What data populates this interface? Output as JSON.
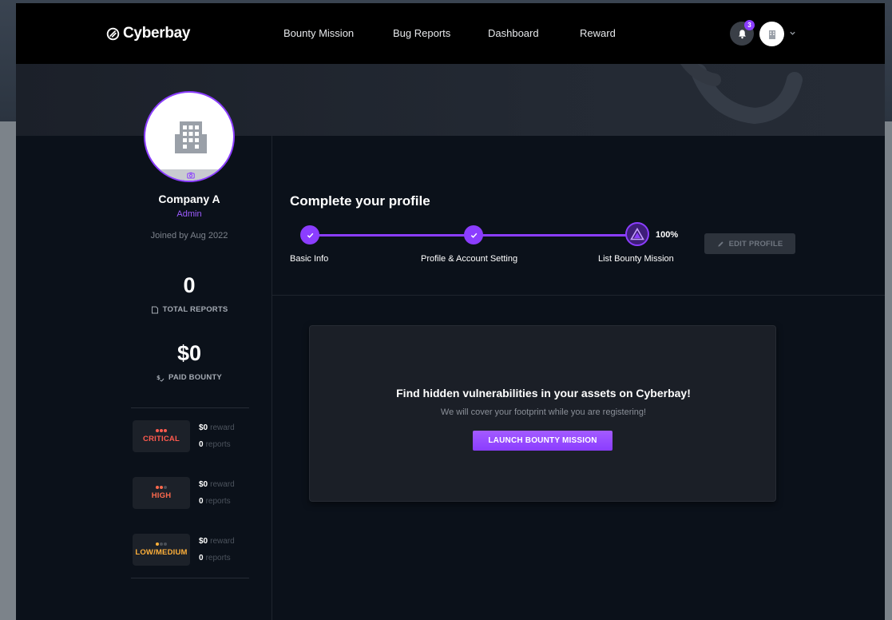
{
  "brand": {
    "name": "Cyberbay"
  },
  "nav": {
    "links": [
      "Bounty Mission",
      "Bug Reports",
      "Dashboard",
      "Reward"
    ]
  },
  "header": {
    "notification_count": "3"
  },
  "profile": {
    "company": "Company A",
    "role": "Admin",
    "joined": "Joined by Aug 2022"
  },
  "stats": {
    "total_reports": {
      "value": "0",
      "label": "TOTAL REPORTS"
    },
    "paid_bounty": {
      "value": "$0",
      "label": "PAID BOUNTY"
    }
  },
  "severities": [
    {
      "label": "CRITICAL",
      "color": "#ff5a4e",
      "reward": "$0",
      "reward_label": "reward",
      "reports": "0",
      "reports_label": "reports"
    },
    {
      "label": "HIGH",
      "color": "#ff6a4d",
      "reward": "$0",
      "reward_label": "reward",
      "reports": "0",
      "reports_label": "reports"
    },
    {
      "label": "LOW/MEDIUM",
      "color": "#ffb03a",
      "reward": "$0",
      "reward_label": "reward",
      "reports": "0",
      "reports_label": "reports"
    }
  ],
  "complete_profile": {
    "title": "Complete your profile",
    "percent": "100%",
    "steps": [
      "Basic Info",
      "Profile & Account Setting",
      "List Bounty Mission"
    ],
    "edit_button": "EDIT PROFILE"
  },
  "cta": {
    "title": "Find hidden vulnerabilities in your assets on Cyberbay!",
    "subtitle": "We will cover your footprint while you are registering!",
    "button": "LAUNCH BOUNTY MISSION"
  },
  "colors": {
    "accent": "#8b3dff",
    "background": "#0b111a",
    "navbar": "#000000"
  }
}
